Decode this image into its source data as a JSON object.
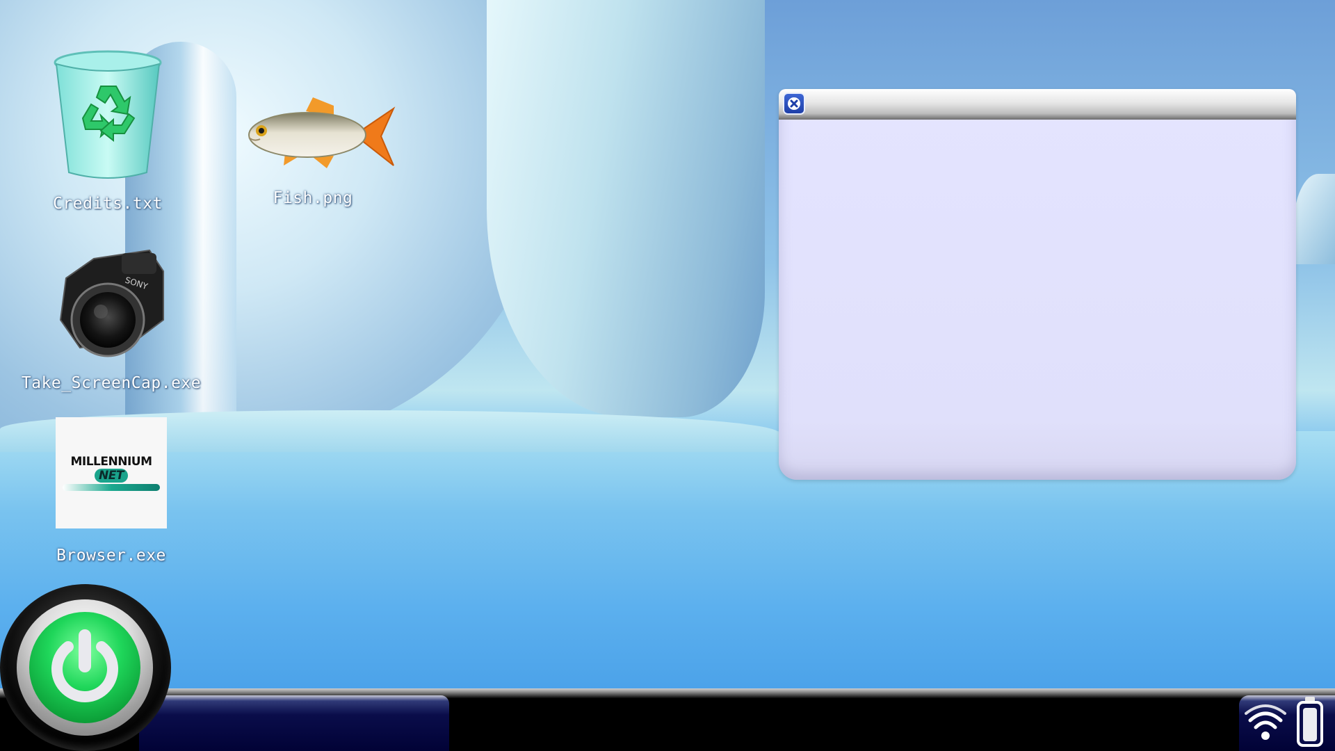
{
  "desktop": {
    "icons": [
      {
        "label": "Credits.txt",
        "icon": "recycle-bin-icon"
      },
      {
        "label": "Fish.png",
        "icon": "fish-icon"
      },
      {
        "label": "Take_ScreenCap.exe",
        "icon": "camera-icon"
      },
      {
        "label": "Browser.exe",
        "icon": "millennium-net-logo-icon"
      }
    ]
  },
  "browser_logo": {
    "text_main": "MILLENNIUM",
    "text_net": "NET"
  },
  "window": {
    "close_icon": "close-icon"
  },
  "taskbar": {
    "power_icon": "power-icon",
    "tray": {
      "wifi_icon": "wifi-icon",
      "battery_icon": "battery-icon"
    }
  },
  "colors": {
    "window_body": "#e2e2fc",
    "close_button": "#2a4fc0",
    "power_green": "#1fd65a",
    "taskbar": "#000000",
    "taskbar_panel": "#010236"
  }
}
